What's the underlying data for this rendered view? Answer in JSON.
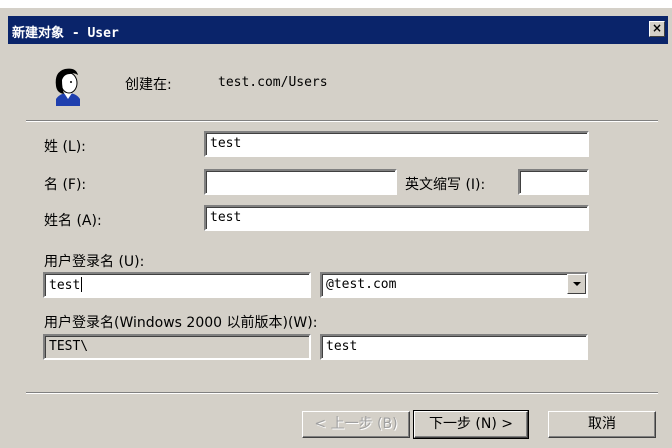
{
  "window": {
    "title": "新建对象 - User",
    "close_symbol": "×",
    "colors": {
      "titlebar": "#0a246a",
      "face": "#d4d0c8"
    }
  },
  "header": {
    "icon": "user-icon",
    "created_in_label": "创建在:",
    "created_in_value": "test.com/Users"
  },
  "form": {
    "last_name_label": "姓 (L):",
    "last_name_value": "test",
    "first_name_label": "名 (F):",
    "first_name_value": "",
    "initials_label": "英文缩写 (I):",
    "initials_value": "",
    "full_name_label": "姓名 (A):",
    "full_name_value": "test",
    "logon_name_label": "用户登录名 (U):",
    "logon_name_value": "test",
    "domain_selected": "@test.com",
    "pre2000_label": "用户登录名(Windows 2000 以前版本)(W):",
    "pre2000_domain": "TEST\\",
    "pre2000_value": "test"
  },
  "buttons": {
    "back": "< 上一步 (B)",
    "next": "下一步 (N) >",
    "cancel": "取消"
  }
}
